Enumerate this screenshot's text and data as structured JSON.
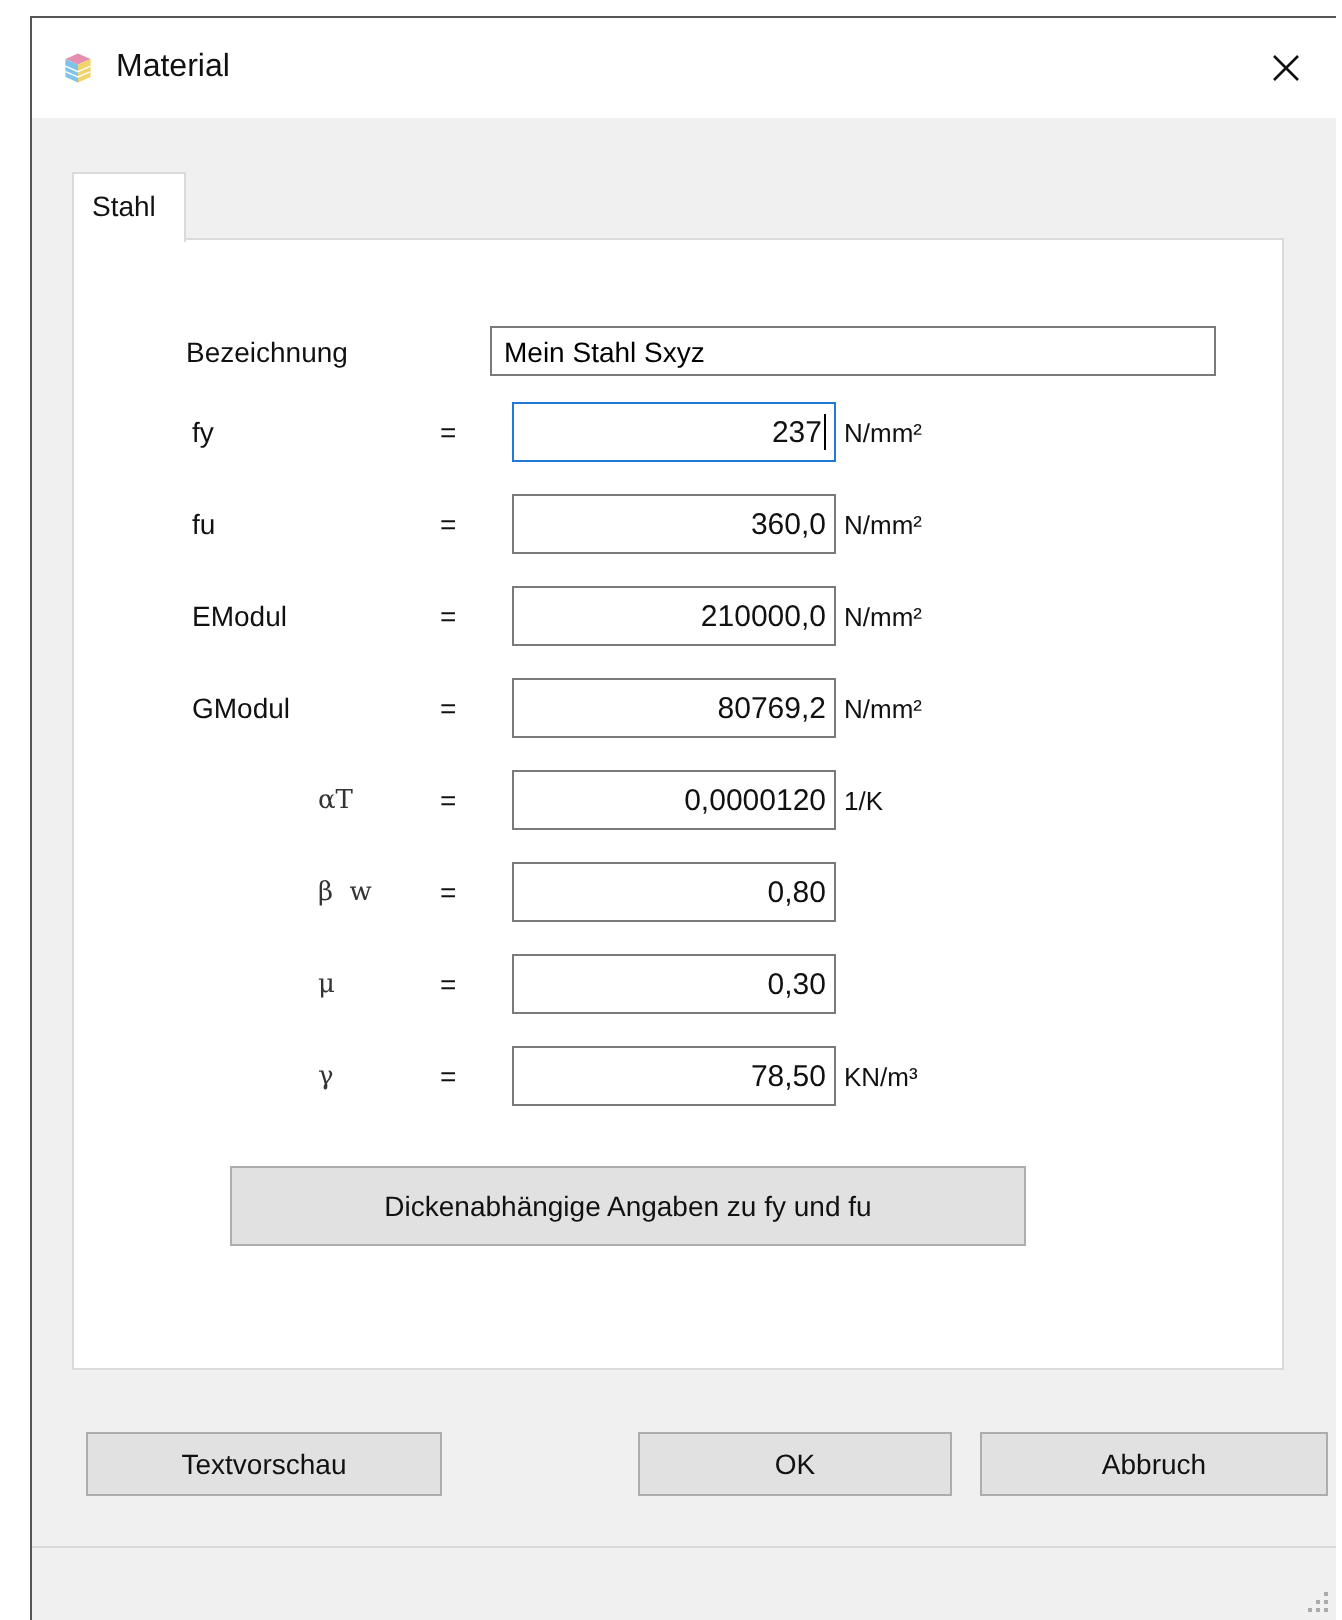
{
  "window": {
    "title": "Material"
  },
  "tabs": [
    {
      "label": "Stahl",
      "selected": true
    }
  ],
  "name_field": {
    "label": "Bezeichnung",
    "value": "Mein Stahl Sxyz"
  },
  "properties": [
    {
      "label": "fy",
      "kind": "word",
      "sign": "=",
      "value": "237",
      "unit": "N/mm²",
      "focused": true
    },
    {
      "label": "fu",
      "kind": "word",
      "sign": "=",
      "value": "360,0",
      "unit": "N/mm²",
      "focused": false
    },
    {
      "label": "EModul",
      "kind": "word",
      "sign": "=",
      "value": "210000,0",
      "unit": "N/mm²",
      "focused": false
    },
    {
      "label": "GModul",
      "kind": "word",
      "sign": "=",
      "value": "80769,2",
      "unit": "N/mm²",
      "focused": false
    },
    {
      "label": "αT",
      "kind": "symbol",
      "sign": "=",
      "value": "0,0000120",
      "unit": "1/K",
      "focused": false
    },
    {
      "label": "β  w",
      "kind": "symbol",
      "sign": "=",
      "value": "0,80",
      "focused": false
    },
    {
      "label": "μ",
      "kind": "symbol",
      "sign": "=",
      "value": "0,30",
      "focused": false
    },
    {
      "label": "γ",
      "kind": "symbol",
      "sign": "=",
      "value": "78,50",
      "unit": "KN/m³",
      "focused": false
    }
  ],
  "thickness_button": "Dickenabhängige Angaben zu fy und fu",
  "buttons": {
    "left": [
      "Textvorschau"
    ],
    "right": [
      "OK",
      "Abbruch"
    ]
  }
}
